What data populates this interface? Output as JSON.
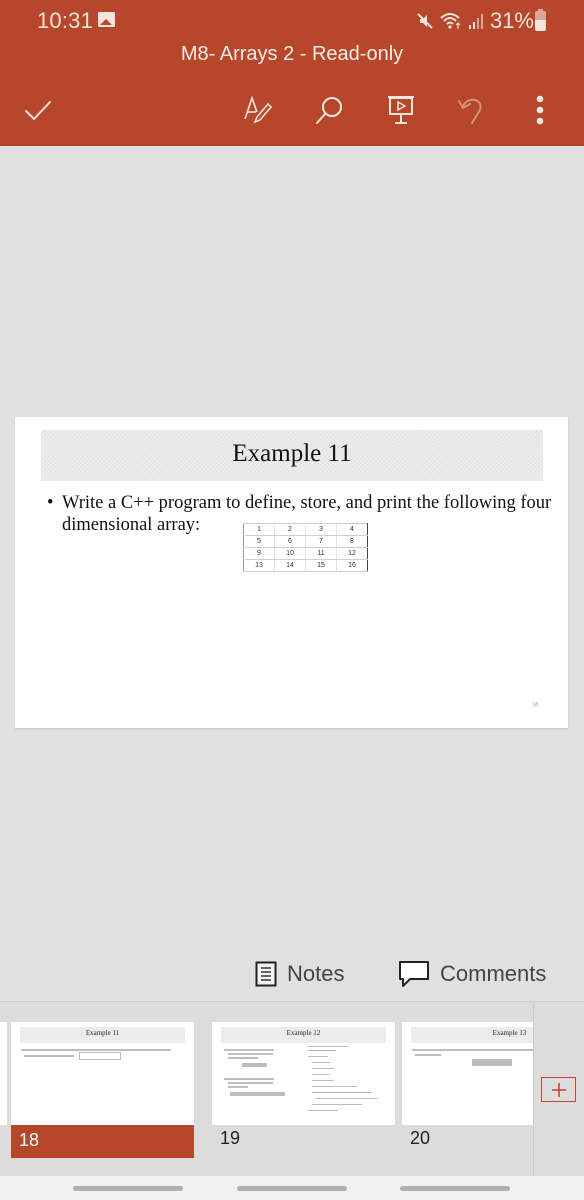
{
  "status_bar": {
    "time": "10:31",
    "battery_percent": "31%",
    "icons": [
      "gallery-icon",
      "mute-icon",
      "wifi-icon",
      "signal-icon",
      "battery-icon"
    ]
  },
  "app_bar": {
    "title": "M8- Arrays 2 - Read-only",
    "toolbar": [
      {
        "name": "done",
        "icon": "checkmark-icon"
      },
      {
        "name": "draw",
        "icon": "pen-draw-icon"
      },
      {
        "name": "search",
        "icon": "search-icon"
      },
      {
        "name": "present",
        "icon": "presentation-icon"
      },
      {
        "name": "undo",
        "icon": "undo-icon"
      },
      {
        "name": "more",
        "icon": "more-vertical-icon"
      }
    ],
    "colors": {
      "brand": "#b7472a"
    }
  },
  "slide": {
    "title": "Example 11",
    "bullet": "Write a C++ program to define, store, and print the following four dimensional array:",
    "bullet_marker": "•",
    "array_table": [
      [
        "1",
        "2",
        "3",
        "4"
      ],
      [
        "5",
        "6",
        "7",
        "8"
      ],
      [
        "9",
        "10",
        "11",
        "12"
      ],
      [
        "13",
        "14",
        "15",
        "16"
      ]
    ],
    "page_number": "18"
  },
  "panels": {
    "notes_label": "Notes",
    "comments_label": "Comments"
  },
  "thumbnails": [
    {
      "number": "18",
      "title": "Example 11",
      "active": true
    },
    {
      "number": "19",
      "title": "Example 12",
      "active": false
    },
    {
      "number": "20",
      "title": "Example 13",
      "active": false
    }
  ],
  "add_slide": {
    "icon": "plus-icon"
  }
}
